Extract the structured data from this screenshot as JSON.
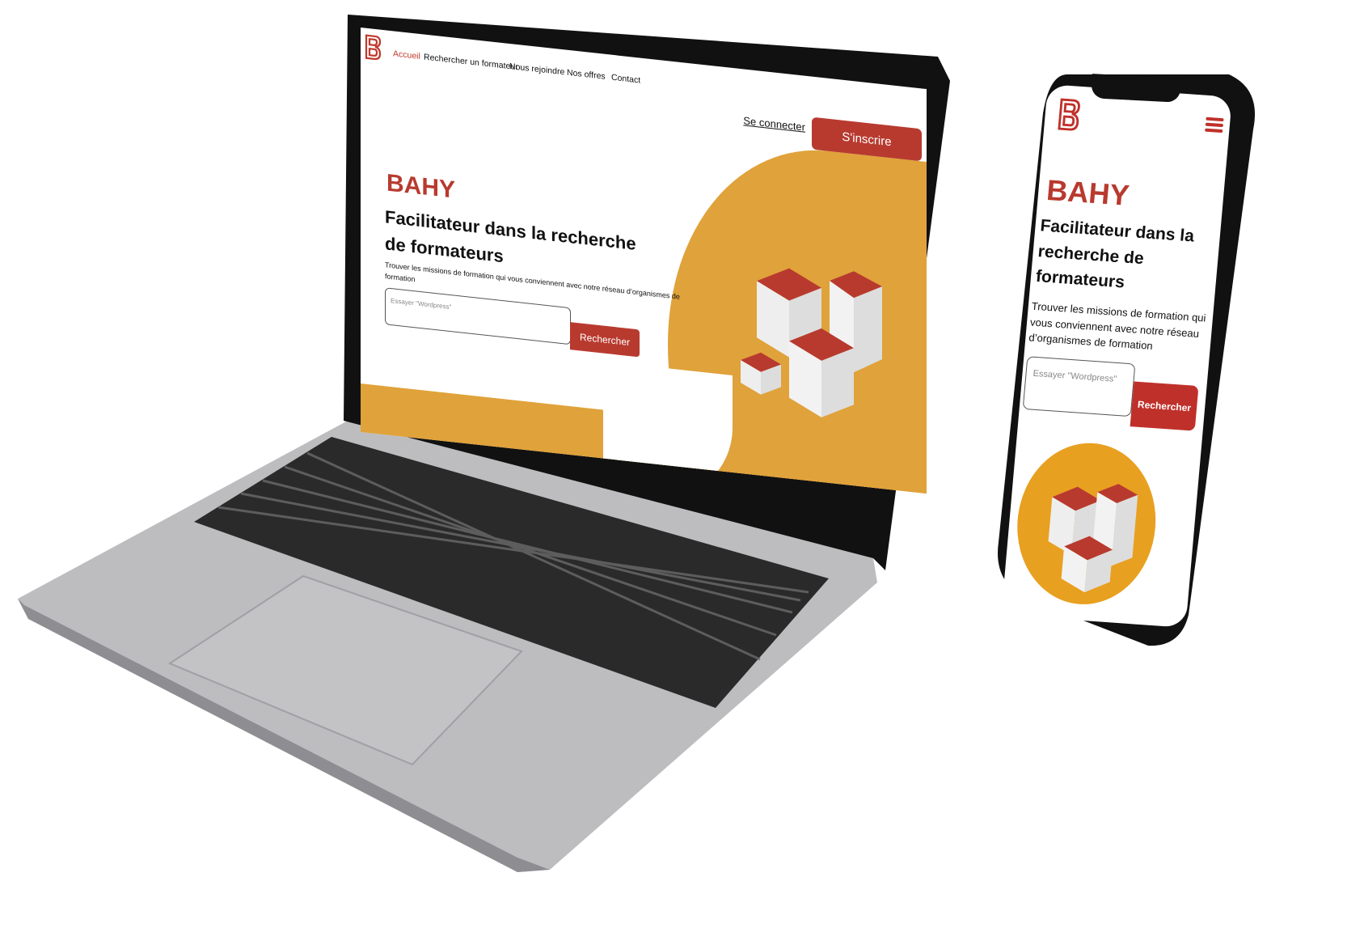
{
  "colors": {
    "brand_red": "#b83a2f",
    "accent_orange": "#e0a23a",
    "device_frame": "#111111",
    "laptop_body": "#bdbdc0"
  },
  "laptop": {
    "nav": {
      "logo": "B",
      "items": [
        {
          "label": "Accueil",
          "active": true
        },
        {
          "label": "Rechercher un formateur"
        },
        {
          "label": "Nous rejoindre"
        },
        {
          "label": "Nos offres"
        },
        {
          "label": "Contact"
        }
      ],
      "login": "Se connecter",
      "signup": "S'inscrire"
    },
    "hero": {
      "brand": "BAHY",
      "headline": "Facilitateur dans la recherche de formateurs",
      "subtitle": "Trouver les missions de formation qui vous conviennent avec notre réseau d’organismes de formation",
      "search_placeholder": "Essayer \"Wordpress\"",
      "search_button": "Rechercher"
    }
  },
  "phone": {
    "logo": "B",
    "menu_icon": "hamburger-icon",
    "hero": {
      "brand": "BAHY",
      "headline": "Facilitateur dans la recherche de formateurs",
      "subtitle": "Trouver les missions de formation qui vous conviennent avec notre réseau d’organismes de formation",
      "search_placeholder": "Essayer \"Wordpress\"",
      "search_button": "Rechercher"
    }
  }
}
